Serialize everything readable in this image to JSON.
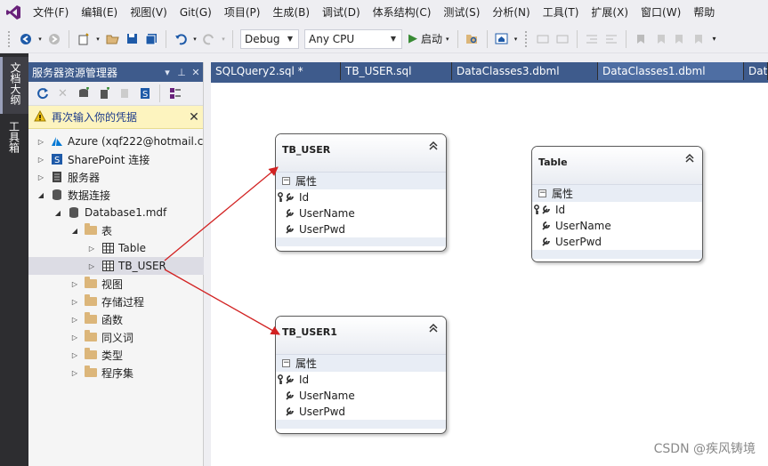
{
  "menu": [
    "文件(F)",
    "编辑(E)",
    "视图(V)",
    "Git(G)",
    "项目(P)",
    "生成(B)",
    "调试(D)",
    "体系结构(C)",
    "测试(S)",
    "分析(N)",
    "工具(T)",
    "扩展(X)",
    "窗口(W)",
    "帮助"
  ],
  "toolbar": {
    "config": "Debug",
    "platform": "Any CPU",
    "start_label": "启动"
  },
  "side_tabs": [
    "文档大纲",
    "工具箱"
  ],
  "explorer": {
    "title": "服务器资源管理器",
    "warning": "再次输入你的凭据",
    "tree": [
      {
        "label": "Azure (xqf222@hotmail.c",
        "level": 0,
        "expander": "▷",
        "icon": "azure-icon"
      },
      {
        "label": "SharePoint 连接",
        "level": 0,
        "expander": "▷",
        "icon": "sharepoint-icon"
      },
      {
        "label": "服务器",
        "level": 0,
        "expander": "▷",
        "icon": "server-icon"
      },
      {
        "label": "数据连接",
        "level": 0,
        "expander": "◢",
        "icon": "data-connections-icon"
      },
      {
        "label": "Database1.mdf",
        "level": 1,
        "expander": "◢",
        "icon": "database-icon"
      },
      {
        "label": "表",
        "level": 2,
        "expander": "◢",
        "icon": "folder-icon"
      },
      {
        "label": "Table",
        "level": 3,
        "expander": "▷",
        "icon": "table-icon"
      },
      {
        "label": "TB_USER",
        "level": 3,
        "expander": "▷",
        "icon": "table-icon",
        "selected": true
      },
      {
        "label": "视图",
        "level": 2,
        "expander": "▷",
        "icon": "folder-icon"
      },
      {
        "label": "存储过程",
        "level": 2,
        "expander": "▷",
        "icon": "folder-icon"
      },
      {
        "label": "函数",
        "level": 2,
        "expander": "▷",
        "icon": "folder-icon"
      },
      {
        "label": "同义词",
        "level": 2,
        "expander": "▷",
        "icon": "folder-icon"
      },
      {
        "label": "类型",
        "level": 2,
        "expander": "▷",
        "icon": "folder-icon"
      },
      {
        "label": "程序集",
        "level": 2,
        "expander": "▷",
        "icon": "folder-icon"
      }
    ]
  },
  "doc_tabs": [
    {
      "label": "SQLQuery2.sql *",
      "active": false
    },
    {
      "label": "TB_USER.sql",
      "active": false
    },
    {
      "label": "DataClasses3.dbml",
      "active": false
    },
    {
      "label": "DataClasses1.dbml",
      "active": true
    },
    {
      "label": "Dat",
      "active": false
    }
  ],
  "entities": [
    {
      "name": "TB_USER",
      "section": "属性",
      "fields": [
        "Id",
        "UserName",
        "UserPwd"
      ]
    },
    {
      "name": "Table",
      "section": "属性",
      "fields": [
        "Id",
        "UserName",
        "UserPwd"
      ]
    },
    {
      "name": "TB_USER1",
      "section": "属性",
      "fields": [
        "Id",
        "UserName",
        "UserPwd"
      ]
    }
  ],
  "watermark": "CSDN @疾风铸境",
  "colors": {
    "title_bar": "#3e5b8c",
    "arrow": "#d22222",
    "vs_purple": "#68217a"
  }
}
